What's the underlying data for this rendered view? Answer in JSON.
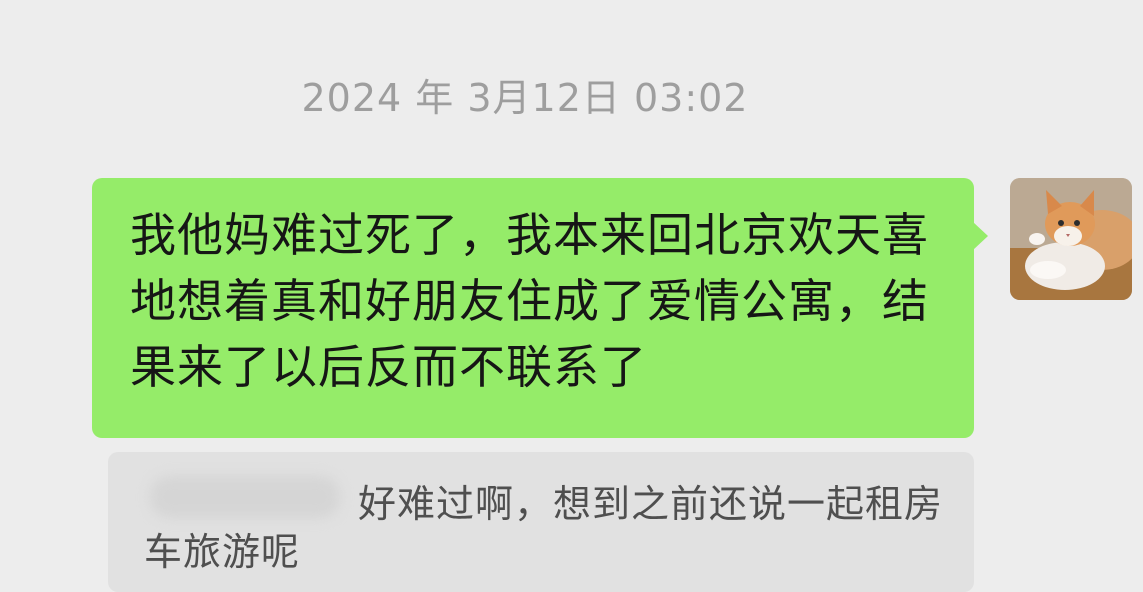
{
  "chat": {
    "timestamp": "2024 年 3月12日 03:02",
    "message": {
      "text": "我他妈难过死了，我本来回北京欢天喜地想着真和好朋友住成了爱情公寓，结果来了以后反而不联系了",
      "bubble_color": "#95ec69"
    },
    "avatar": {
      "icon": "cat-photo-icon"
    },
    "quote": {
      "text": "好难过啊，想到之前还说一起租房车旅游呢"
    }
  }
}
